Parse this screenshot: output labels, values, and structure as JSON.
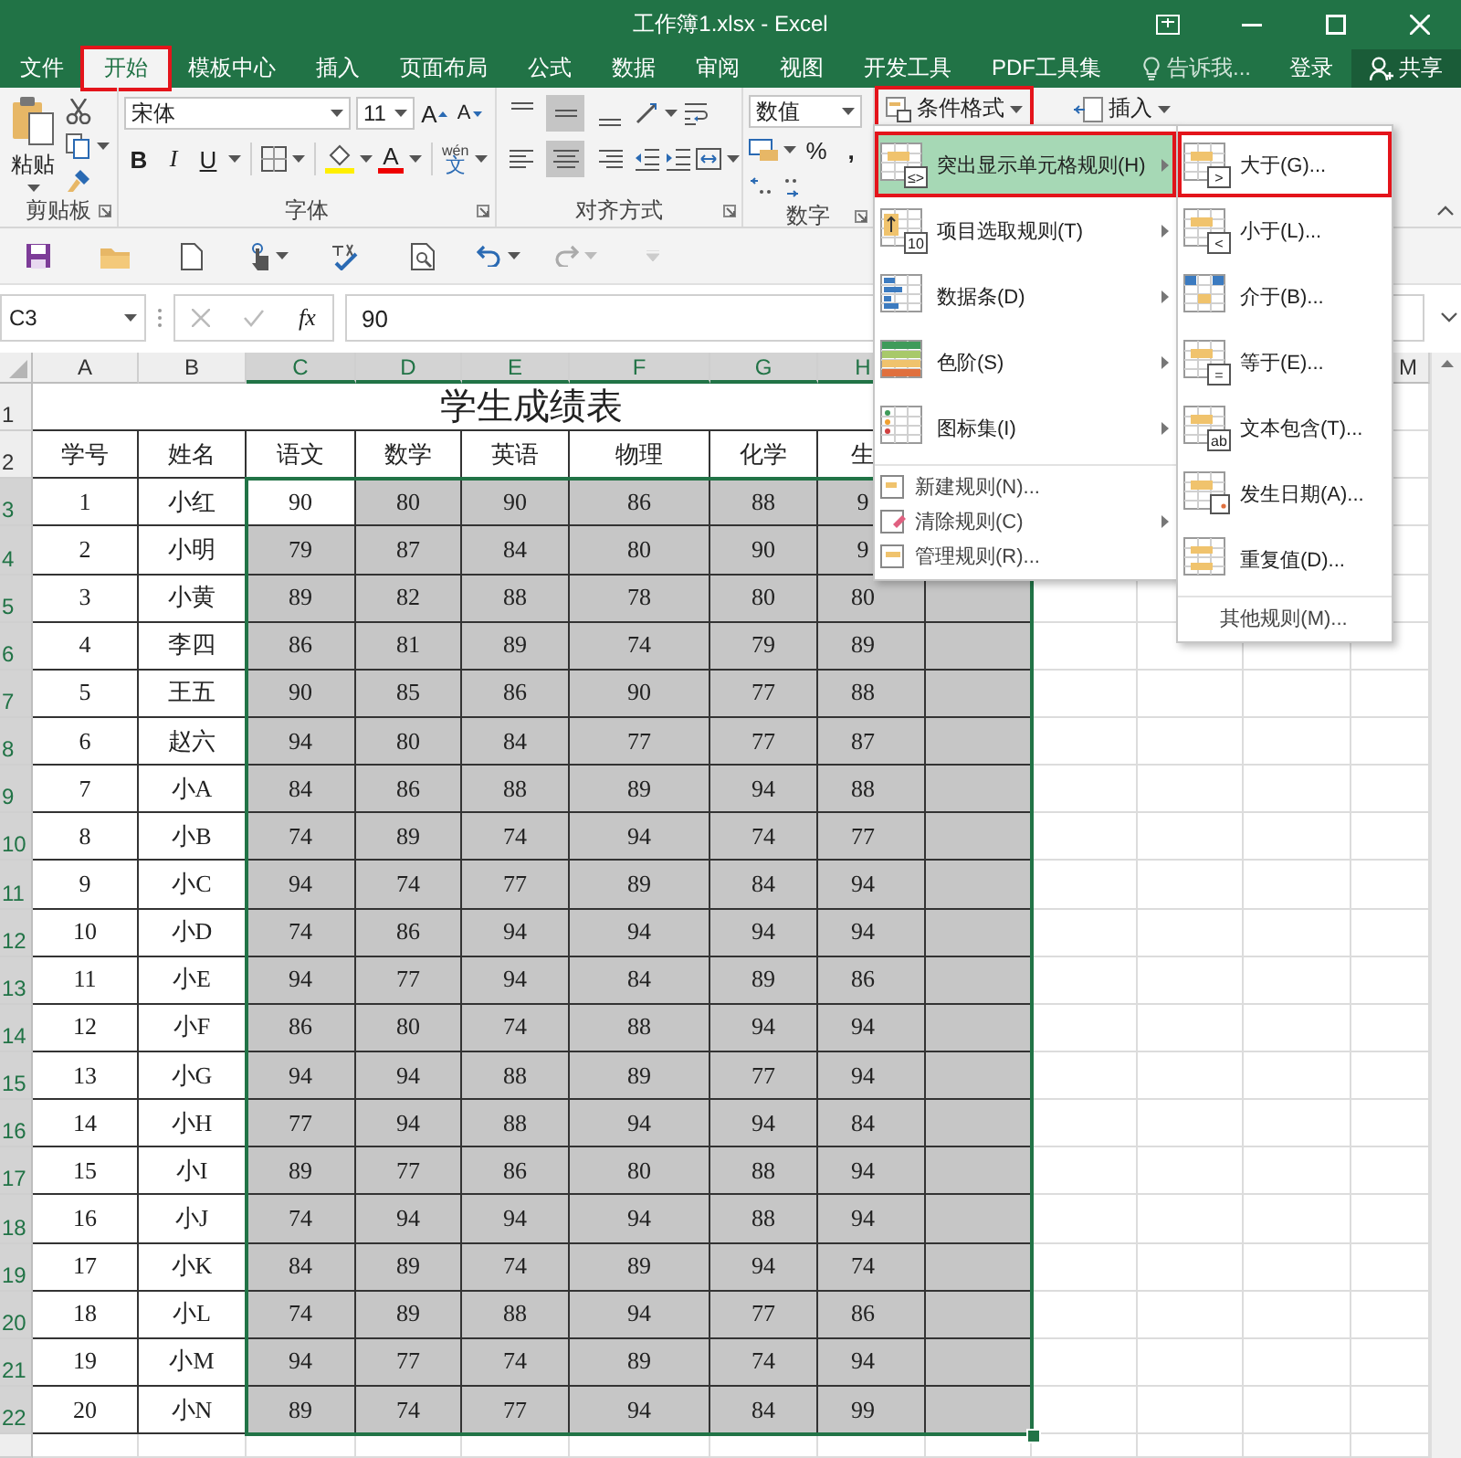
{
  "window": {
    "title": "工作簿1.xlsx - Excel"
  },
  "tabs": [
    {
      "label": "文件",
      "selected": false,
      "marked": false
    },
    {
      "label": "开始",
      "selected": true,
      "marked": true
    },
    {
      "label": "模板中心",
      "selected": false,
      "marked": false
    },
    {
      "label": "插入",
      "selected": false,
      "marked": false
    },
    {
      "label": "页面布局",
      "selected": false,
      "marked": false
    },
    {
      "label": "公式",
      "selected": false,
      "marked": false
    },
    {
      "label": "数据",
      "selected": false,
      "marked": false
    },
    {
      "label": "审阅",
      "selected": false,
      "marked": false
    },
    {
      "label": "视图",
      "selected": false,
      "marked": false
    },
    {
      "label": "开发工具",
      "selected": false,
      "marked": false
    },
    {
      "label": "PDF工具集",
      "selected": false,
      "marked": false
    }
  ],
  "tell_me": {
    "placeholder": "告诉我..."
  },
  "account": {
    "sign_in": "登录",
    "share": "共享"
  },
  "ribbon": {
    "clipboard": {
      "paste": "粘贴",
      "label": "剪贴板"
    },
    "font": {
      "name": "宋体",
      "size": "11",
      "grow": "A",
      "shrink": "A",
      "bold": "B",
      "italic": "I",
      "underline": "U",
      "font_color": "A",
      "phonetic_top": "wén",
      "phonetic": "文",
      "label": "字体"
    },
    "alignment": {
      "label": "对齐方式",
      "top_row": [
        {
          "selected": false
        },
        {
          "selected": true
        },
        {
          "selected": false
        }
      ],
      "bottom_row": [
        {
          "selected": false
        },
        {
          "selected": true
        },
        {
          "selected": false
        }
      ]
    },
    "number": {
      "format": "数值",
      "percent": "%",
      "comma": ",",
      "label": "数字"
    },
    "styles": {
      "conditional_format": {
        "label": "条件格式",
        "marked": true
      }
    },
    "cells": {
      "insert": "插入"
    }
  },
  "name_box": "C3",
  "formula": {
    "function_label": "fx",
    "value": "90"
  },
  "sheet": {
    "title": "学生成绩表",
    "columns": [
      {
        "label": "A",
        "selected": false
      },
      {
        "label": "B",
        "selected": false
      },
      {
        "label": "C",
        "selected": true
      },
      {
        "label": "D",
        "selected": true
      },
      {
        "label": "E",
        "selected": true
      },
      {
        "label": "F",
        "selected": true
      },
      {
        "label": "G",
        "selected": true
      },
      {
        "label": "H",
        "selected": true
      }
    ],
    "right_columns": [
      {
        "label": "M",
        "selected": false
      }
    ],
    "title_row": {
      "number": "1",
      "selected": false
    },
    "header_row": {
      "number": "2",
      "selected": false,
      "cells": [
        "学号",
        "姓名",
        "语文",
        "数学",
        "英语",
        "物理",
        "化学",
        "生"
      ]
    },
    "rows": [
      {
        "number": "3",
        "selected": true,
        "cells": [
          {
            "text": "1",
            "selected": false,
            "active": false
          },
          {
            "text": "小红",
            "selected": false,
            "active": false
          },
          {
            "text": "90",
            "selected": true,
            "active": true
          },
          {
            "text": "80",
            "selected": true,
            "active": false
          },
          {
            "text": "90",
            "selected": true,
            "active": false
          },
          {
            "text": "86",
            "selected": true,
            "active": false
          },
          {
            "text": "88",
            "selected": true,
            "active": false
          },
          {
            "text": "9",
            "selected": true,
            "active": false
          }
        ]
      },
      {
        "number": "4",
        "selected": true,
        "cells": [
          {
            "text": "2",
            "selected": false,
            "active": false
          },
          {
            "text": "小明",
            "selected": false,
            "active": false
          },
          {
            "text": "79",
            "selected": true,
            "active": false
          },
          {
            "text": "87",
            "selected": true,
            "active": false
          },
          {
            "text": "84",
            "selected": true,
            "active": false
          },
          {
            "text": "80",
            "selected": true,
            "active": false
          },
          {
            "text": "90",
            "selected": true,
            "active": false
          },
          {
            "text": "9",
            "selected": true,
            "active": false
          }
        ]
      },
      {
        "number": "5",
        "selected": true,
        "cells": [
          {
            "text": "3",
            "selected": false,
            "active": false
          },
          {
            "text": "小黄",
            "selected": false,
            "active": false
          },
          {
            "text": "89",
            "selected": true,
            "active": false
          },
          {
            "text": "82",
            "selected": true,
            "active": false
          },
          {
            "text": "88",
            "selected": true,
            "active": false
          },
          {
            "text": "78",
            "selected": true,
            "active": false
          },
          {
            "text": "80",
            "selected": true,
            "active": false
          },
          {
            "text": "80",
            "selected": true,
            "active": false
          },
          {
            "selected": true,
            "active": false
          }
        ]
      },
      {
        "number": "6",
        "selected": true,
        "cells": [
          {
            "text": "4",
            "selected": false,
            "active": false
          },
          {
            "text": "李四",
            "selected": false,
            "active": false
          },
          {
            "text": "86",
            "selected": true,
            "active": false
          },
          {
            "text": "81",
            "selected": true,
            "active": false
          },
          {
            "text": "89",
            "selected": true,
            "active": false
          },
          {
            "text": "74",
            "selected": true,
            "active": false
          },
          {
            "text": "79",
            "selected": true,
            "active": false
          },
          {
            "text": "89",
            "selected": true,
            "active": false
          },
          {
            "selected": true,
            "active": false
          }
        ]
      },
      {
        "number": "7",
        "selected": true,
        "cells": [
          {
            "text": "5",
            "selected": false,
            "active": false
          },
          {
            "text": "王五",
            "selected": false,
            "active": false
          },
          {
            "text": "90",
            "selected": true,
            "active": false
          },
          {
            "text": "85",
            "selected": true,
            "active": false
          },
          {
            "text": "86",
            "selected": true,
            "active": false
          },
          {
            "text": "90",
            "selected": true,
            "active": false
          },
          {
            "text": "77",
            "selected": true,
            "active": false
          },
          {
            "text": "88",
            "selected": true,
            "active": false
          },
          {
            "selected": true,
            "active": false
          }
        ]
      },
      {
        "number": "8",
        "selected": true,
        "cells": [
          {
            "text": "6",
            "selected": false,
            "active": false
          },
          {
            "text": "赵六",
            "selected": false,
            "active": false
          },
          {
            "text": "94",
            "selected": true,
            "active": false
          },
          {
            "text": "80",
            "selected": true,
            "active": false
          },
          {
            "text": "84",
            "selected": true,
            "active": false
          },
          {
            "text": "77",
            "selected": true,
            "active": false
          },
          {
            "text": "77",
            "selected": true,
            "active": false
          },
          {
            "text": "87",
            "selected": true,
            "active": false
          },
          {
            "selected": true,
            "active": false
          }
        ]
      },
      {
        "number": "9",
        "selected": true,
        "cells": [
          {
            "text": "7",
            "selected": false,
            "active": false
          },
          {
            "text": "小A",
            "selected": false,
            "active": false
          },
          {
            "text": "84",
            "selected": true,
            "active": false
          },
          {
            "text": "86",
            "selected": true,
            "active": false
          },
          {
            "text": "88",
            "selected": true,
            "active": false
          },
          {
            "text": "89",
            "selected": true,
            "active": false
          },
          {
            "text": "94",
            "selected": true,
            "active": false
          },
          {
            "text": "88",
            "selected": true,
            "active": false
          },
          {
            "selected": true,
            "active": false
          }
        ]
      },
      {
        "number": "10",
        "selected": true,
        "cells": [
          {
            "text": "8",
            "selected": false,
            "active": false
          },
          {
            "text": "小B",
            "selected": false,
            "active": false
          },
          {
            "text": "74",
            "selected": true,
            "active": false
          },
          {
            "text": "89",
            "selected": true,
            "active": false
          },
          {
            "text": "74",
            "selected": true,
            "active": false
          },
          {
            "text": "94",
            "selected": true,
            "active": false
          },
          {
            "text": "74",
            "selected": true,
            "active": false
          },
          {
            "text": "77",
            "selected": true,
            "active": false
          },
          {
            "selected": true,
            "active": false
          }
        ]
      },
      {
        "number": "11",
        "selected": true,
        "cells": [
          {
            "text": "9",
            "selected": false,
            "active": false
          },
          {
            "text": "小C",
            "selected": false,
            "active": false
          },
          {
            "text": "94",
            "selected": true,
            "active": false
          },
          {
            "text": "74",
            "selected": true,
            "active": false
          },
          {
            "text": "77",
            "selected": true,
            "active": false
          },
          {
            "text": "89",
            "selected": true,
            "active": false
          },
          {
            "text": "84",
            "selected": true,
            "active": false
          },
          {
            "text": "94",
            "selected": true,
            "active": false
          },
          {
            "selected": true,
            "active": false
          }
        ]
      },
      {
        "number": "12",
        "selected": true,
        "cells": [
          {
            "text": "10",
            "selected": false,
            "active": false
          },
          {
            "text": "小D",
            "selected": false,
            "active": false
          },
          {
            "text": "74",
            "selected": true,
            "active": false
          },
          {
            "text": "86",
            "selected": true,
            "active": false
          },
          {
            "text": "94",
            "selected": true,
            "active": false
          },
          {
            "text": "94",
            "selected": true,
            "active": false
          },
          {
            "text": "94",
            "selected": true,
            "active": false
          },
          {
            "text": "94",
            "selected": true,
            "active": false
          },
          {
            "selected": true,
            "active": false
          }
        ]
      },
      {
        "number": "13",
        "selected": true,
        "cells": [
          {
            "text": "11",
            "selected": false,
            "active": false
          },
          {
            "text": "小E",
            "selected": false,
            "active": false
          },
          {
            "text": "94",
            "selected": true,
            "active": false
          },
          {
            "text": "77",
            "selected": true,
            "active": false
          },
          {
            "text": "94",
            "selected": true,
            "active": false
          },
          {
            "text": "84",
            "selected": true,
            "active": false
          },
          {
            "text": "89",
            "selected": true,
            "active": false
          },
          {
            "text": "86",
            "selected": true,
            "active": false
          },
          {
            "selected": true,
            "active": false
          }
        ]
      },
      {
        "number": "14",
        "selected": true,
        "cells": [
          {
            "text": "12",
            "selected": false,
            "active": false
          },
          {
            "text": "小F",
            "selected": false,
            "active": false
          },
          {
            "text": "86",
            "selected": true,
            "active": false
          },
          {
            "text": "80",
            "selected": true,
            "active": false
          },
          {
            "text": "74",
            "selected": true,
            "active": false
          },
          {
            "text": "88",
            "selected": true,
            "active": false
          },
          {
            "text": "94",
            "selected": true,
            "active": false
          },
          {
            "text": "94",
            "selected": true,
            "active": false
          },
          {
            "selected": true,
            "active": false
          }
        ]
      },
      {
        "number": "15",
        "selected": true,
        "cells": [
          {
            "text": "13",
            "selected": false,
            "active": false
          },
          {
            "text": "小G",
            "selected": false,
            "active": false
          },
          {
            "text": "94",
            "selected": true,
            "active": false
          },
          {
            "text": "94",
            "selected": true,
            "active": false
          },
          {
            "text": "88",
            "selected": true,
            "active": false
          },
          {
            "text": "89",
            "selected": true,
            "active": false
          },
          {
            "text": "77",
            "selected": true,
            "active": false
          },
          {
            "text": "94",
            "selected": true,
            "active": false
          },
          {
            "selected": true,
            "active": false
          }
        ]
      },
      {
        "number": "16",
        "selected": true,
        "cells": [
          {
            "text": "14",
            "selected": false,
            "active": false
          },
          {
            "text": "小H",
            "selected": false,
            "active": false
          },
          {
            "text": "77",
            "selected": true,
            "active": false
          },
          {
            "text": "94",
            "selected": true,
            "active": false
          },
          {
            "text": "88",
            "selected": true,
            "active": false
          },
          {
            "text": "94",
            "selected": true,
            "active": false
          },
          {
            "text": "94",
            "selected": true,
            "active": false
          },
          {
            "text": "84",
            "selected": true,
            "active": false
          },
          {
            "selected": true,
            "active": false
          }
        ]
      },
      {
        "number": "17",
        "selected": true,
        "cells": [
          {
            "text": "15",
            "selected": false,
            "active": false
          },
          {
            "text": "小I",
            "selected": false,
            "active": false
          },
          {
            "text": "89",
            "selected": true,
            "active": false
          },
          {
            "text": "77",
            "selected": true,
            "active": false
          },
          {
            "text": "86",
            "selected": true,
            "active": false
          },
          {
            "text": "80",
            "selected": true,
            "active": false
          },
          {
            "text": "88",
            "selected": true,
            "active": false
          },
          {
            "text": "94",
            "selected": true,
            "active": false
          },
          {
            "selected": true,
            "active": false
          }
        ]
      },
      {
        "number": "18",
        "selected": true,
        "cells": [
          {
            "text": "16",
            "selected": false,
            "active": false
          },
          {
            "text": "小J",
            "selected": false,
            "active": false
          },
          {
            "text": "74",
            "selected": true,
            "active": false
          },
          {
            "text": "94",
            "selected": true,
            "active": false
          },
          {
            "text": "94",
            "selected": true,
            "active": false
          },
          {
            "text": "94",
            "selected": true,
            "active": false
          },
          {
            "text": "88",
            "selected": true,
            "active": false
          },
          {
            "text": "94",
            "selected": true,
            "active": false
          },
          {
            "selected": true,
            "active": false
          }
        ]
      },
      {
        "number": "19",
        "selected": true,
        "cells": [
          {
            "text": "17",
            "selected": false,
            "active": false
          },
          {
            "text": "小K",
            "selected": false,
            "active": false
          },
          {
            "text": "84",
            "selected": true,
            "active": false
          },
          {
            "text": "89",
            "selected": true,
            "active": false
          },
          {
            "text": "74",
            "selected": true,
            "active": false
          },
          {
            "text": "89",
            "selected": true,
            "active": false
          },
          {
            "text": "94",
            "selected": true,
            "active": false
          },
          {
            "text": "74",
            "selected": true,
            "active": false
          },
          {
            "selected": true,
            "active": false
          }
        ]
      },
      {
        "number": "20",
        "selected": true,
        "cells": [
          {
            "text": "18",
            "selected": false,
            "active": false
          },
          {
            "text": "小L",
            "selected": false,
            "active": false
          },
          {
            "text": "74",
            "selected": true,
            "active": false
          },
          {
            "text": "89",
            "selected": true,
            "active": false
          },
          {
            "text": "88",
            "selected": true,
            "active": false
          },
          {
            "text": "94",
            "selected": true,
            "active": false
          },
          {
            "text": "77",
            "selected": true,
            "active": false
          },
          {
            "text": "86",
            "selected": true,
            "active": false
          },
          {
            "selected": true,
            "active": false
          }
        ]
      },
      {
        "number": "21",
        "selected": true,
        "cells": [
          {
            "text": "19",
            "selected": false,
            "active": false
          },
          {
            "text": "小M",
            "selected": false,
            "active": false
          },
          {
            "text": "94",
            "selected": true,
            "active": false
          },
          {
            "text": "77",
            "selected": true,
            "active": false
          },
          {
            "text": "74",
            "selected": true,
            "active": false
          },
          {
            "text": "89",
            "selected": true,
            "active": false
          },
          {
            "text": "74",
            "selected": true,
            "active": false
          },
          {
            "text": "94",
            "selected": true,
            "active": false
          },
          {
            "selected": true,
            "active": false
          }
        ]
      },
      {
        "number": "22",
        "selected": true,
        "cells": [
          {
            "text": "20",
            "selected": false,
            "active": false
          },
          {
            "text": "小N",
            "selected": false,
            "active": false
          },
          {
            "text": "89",
            "selected": true,
            "active": false
          },
          {
            "text": "74",
            "selected": true,
            "active": false
          },
          {
            "text": "77",
            "selected": true,
            "active": false
          },
          {
            "text": "94",
            "selected": true,
            "active": false
          },
          {
            "text": "84",
            "selected": true,
            "active": false
          },
          {
            "text": "99",
            "selected": true,
            "active": false
          },
          {
            "selected": true,
            "active": false
          }
        ]
      }
    ]
  },
  "menu": {
    "items": [
      {
        "label": "突出显示单元格规则(H)",
        "kind": "large",
        "submenu": true,
        "selected": true,
        "marked": true,
        "icon_text": "≤>"
      },
      {
        "label": "项目选取规则(T)",
        "kind": "large",
        "submenu": true,
        "selected": false,
        "marked": false,
        "icon_text": "10"
      },
      {
        "label": "数据条(D)",
        "kind": "large",
        "submenu": true,
        "selected": false,
        "marked": false
      },
      {
        "label": "色阶(S)",
        "kind": "large",
        "submenu": true,
        "selected": false,
        "marked": false
      },
      {
        "label": "图标集(I)",
        "kind": "large",
        "submenu": true,
        "selected": false,
        "marked": false
      },
      {
        "label": "新建规则(N)...",
        "kind": "small",
        "submenu": false,
        "selected": false,
        "marked": false
      },
      {
        "label": "清除规则(C)",
        "kind": "small",
        "submenu": true,
        "selected": false,
        "marked": false
      },
      {
        "label": "管理规则(R)...",
        "kind": "small",
        "submenu": false,
        "selected": false,
        "marked": false
      }
    ]
  },
  "submenu": {
    "items": [
      {
        "label": "大于(G)...",
        "kind": "large",
        "marked": true,
        "icon_text": ">"
      },
      {
        "label": "小于(L)...",
        "kind": "large",
        "marked": false,
        "icon_text": "<"
      },
      {
        "label": "介于(B)...",
        "kind": "large",
        "marked": false
      },
      {
        "label": "等于(E)...",
        "kind": "large",
        "marked": false,
        "icon_text": "="
      },
      {
        "label": "文本包含(T)...",
        "kind": "large",
        "marked": false,
        "icon_text": "ab"
      },
      {
        "label": "发生日期(A)...",
        "kind": "large",
        "marked": false
      },
      {
        "label": "重复值(D)...",
        "kind": "large",
        "marked": false
      },
      {
        "label": "其他规则(M)...",
        "kind": "small",
        "marked": false
      }
    ]
  }
}
